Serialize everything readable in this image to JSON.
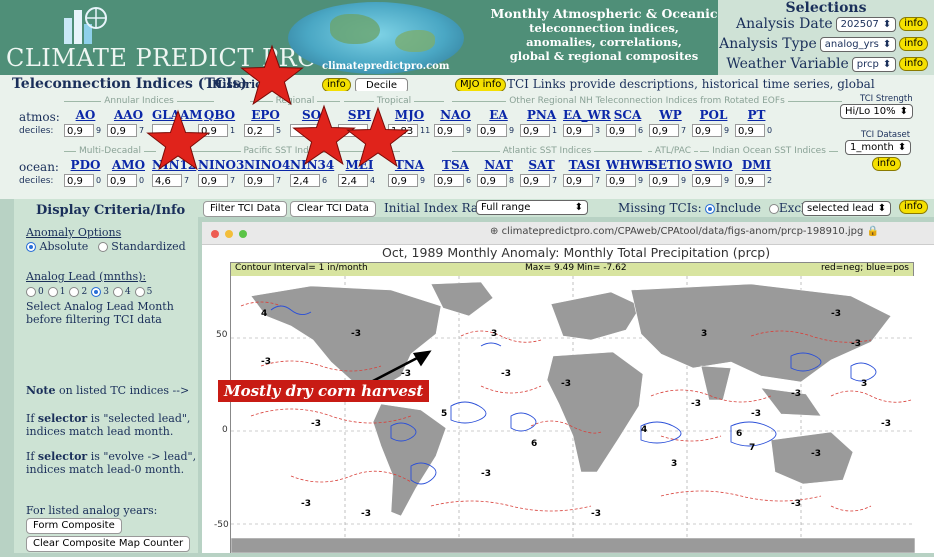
{
  "header": {
    "logo_text": "CLIMATE PREDICT PRO",
    "site_url": "climatepredictpro.com",
    "description_lines": [
      "Monthly Atmospheric & Oceanic",
      "teleconnection indices,",
      "anomalies, correlations,",
      "global & regional composites"
    ]
  },
  "selections": {
    "title": "Selections",
    "analysis_date_label": "Analysis Date",
    "analysis_date_value": "202507",
    "analysis_type_label": "Analysis Type",
    "analysis_type_value": "analog_yrs",
    "weather_variable_label": "Weather Variable",
    "weather_variable_value": "prcp",
    "info_label": "info"
  },
  "tci": {
    "title": "Teleconnection Indices (TCIs)",
    "historical_label": "Historical",
    "data_label": "ata",
    "info_label": "info",
    "decile_button": "Decile",
    "mjo_info": "MJO info",
    "links_text": "TCI Links provide descriptions, historical time series, global composite signatures, etc.",
    "atmos_label": "atmos:",
    "ocean_label": "ocean:",
    "deciles_label": "deciles:",
    "groups": {
      "annular": "Annular Indices",
      "regional": "Regional",
      "tropical": "Tropical",
      "nh_eof": "Other Regional NH Teleconnection Indices from Rotated EOFs",
      "multidecadal": "Multi-Decadal",
      "pacific_sst": "Pacific SST Indices",
      "atlantic_sst": "Atlantic SST Indices",
      "atl_pac": "ATL/PAC",
      "indian_sst": "Indian Ocean SST Indices"
    },
    "atmos": [
      {
        "name": "AO",
        "value": "0,9",
        "decile": "9"
      },
      {
        "name": "AAO",
        "value": "0,9",
        "decile": "7"
      },
      {
        "name": "GLAAM",
        "value": "",
        "decile": ""
      },
      {
        "name": "QBO",
        "value": "0,9",
        "decile": "1"
      },
      {
        "name": "EPO",
        "value": "0,2",
        "decile": "5"
      },
      {
        "name": "SO",
        "value": "",
        "decile": ""
      },
      {
        "name": "SPI",
        "value": "",
        "decile": ""
      },
      {
        "name": "MJO",
        "value": "1,83",
        "decile": "11"
      },
      {
        "name": "NAO",
        "value": "0,9",
        "decile": "9"
      },
      {
        "name": "EA",
        "value": "0,9",
        "decile": "9"
      },
      {
        "name": "PNA",
        "value": "0,9",
        "decile": "1"
      },
      {
        "name": "EA_WR",
        "value": "0,9",
        "decile": "3"
      },
      {
        "name": "SCA",
        "value": "0,9",
        "decile": "6"
      },
      {
        "name": "WP",
        "value": "0,9",
        "decile": "7"
      },
      {
        "name": "POL",
        "value": "0,9",
        "decile": "9"
      },
      {
        "name": "PT",
        "value": "0,9",
        "decile": "0"
      }
    ],
    "ocean": [
      {
        "name": "PDO",
        "value": "0,9",
        "decile": "0"
      },
      {
        "name": "AMO",
        "value": "0,9",
        "decile": "0"
      },
      {
        "name": "NIN12",
        "value": "4,6",
        "decile": "7"
      },
      {
        "name": "NINO3",
        "value": "0,9",
        "decile": "7"
      },
      {
        "name": "NINO4",
        "value": "0,9",
        "decile": "7"
      },
      {
        "name": "NIN34",
        "value": "2,4",
        "decile": "6"
      },
      {
        "name": "MEI",
        "value": "2,4",
        "decile": "4"
      },
      {
        "name": "TNA",
        "value": "0,9",
        "decile": "9"
      },
      {
        "name": "TSA",
        "value": "0,9",
        "decile": "6"
      },
      {
        "name": "NAT",
        "value": "0,9",
        "decile": "8"
      },
      {
        "name": "SAT",
        "value": "0,9",
        "decile": "7"
      },
      {
        "name": "TASI",
        "value": "0,9",
        "decile": "7"
      },
      {
        "name": "WHWP",
        "value": "0,9",
        "decile": "9"
      },
      {
        "name": "SETIO",
        "value": "0,9",
        "decile": "9"
      },
      {
        "name": "SWIO",
        "value": "0,9",
        "decile": "9"
      },
      {
        "name": "DMI",
        "value": "0,9",
        "decile": "2"
      }
    ],
    "strength_label": "TCI Strength",
    "strength_value": "Hi/Lo 10%",
    "dataset_label": "TCI Dataset",
    "dataset_value": "1_month"
  },
  "left_panel": {
    "title": "Display Criteria/Info",
    "anomaly_options": "Anomaly Options",
    "absolute": "Absolute",
    "standardized": "Standardized",
    "analog_lead": "Analog Lead (mnths):",
    "leads": [
      "0",
      "1",
      "2",
      "3",
      "4",
      "5"
    ],
    "select_lead_text_1": "Select Analog Lead Month",
    "select_lead_text_2": "before filtering TCI data",
    "note_1": "Note",
    "note_2": " on listed TC indices  -->",
    "selector_1a": "If ",
    "selector_1b": "selector",
    "selector_1c": " is \"selected lead\",",
    "selector_1d": "indices match lead month.",
    "selector_2c": " is \"evolve -> lead\",",
    "selector_2d": "indices match lead-0 month.",
    "analog_years": "For listed analog years:",
    "form_composite": "Form Composite",
    "clear_composite": "Clear Composite Map Counter"
  },
  "filter_bar": {
    "filter_button": "Filter TCI Data",
    "clear_button": "Clear TCI Data",
    "range_label": "Initial Index Range:",
    "range_value": "Full range",
    "missing_label": "Missing TCIs:",
    "include": "Include",
    "exclude": "Exclude",
    "lead_value": "selected lead",
    "info_label": "info"
  },
  "browser": {
    "url": "climatepredictpro.com/CPAweb/CPAtool/data/figs-anom/prcp-198910.jpg",
    "map_title": "Oct, 1989  Monthly Anomaly: Monthly Total Precipitation (prcp)",
    "contour_interval": "Contour Interval= 1 in/month",
    "max_min": "Max= 9.49  Min= -7.62",
    "legend": "red=neg; blue=pos",
    "y_labels": [
      "50",
      "0",
      "-50"
    ],
    "map_numbers": [
      "-3",
      "-3",
      "-3",
      "-3",
      "-3",
      "4",
      "5",
      "-3",
      "6",
      "3",
      "-3",
      "4",
      "3",
      "3",
      "-3",
      "-3",
      "6",
      "-3",
      "-3",
      "-3",
      "3",
      "-3",
      "-3",
      "7",
      "-3",
      "-3",
      "-3",
      "-3"
    ]
  },
  "annotation": {
    "text": "Mostly dry corn harvest"
  },
  "colors": {
    "header_green": "#4f8f78",
    "link_blue": "#0b27a8",
    "star_red": "#e0231b",
    "annotation_red": "#c81b14",
    "positive_blue": "#2a4fd8",
    "negative_red": "#d8403a"
  }
}
